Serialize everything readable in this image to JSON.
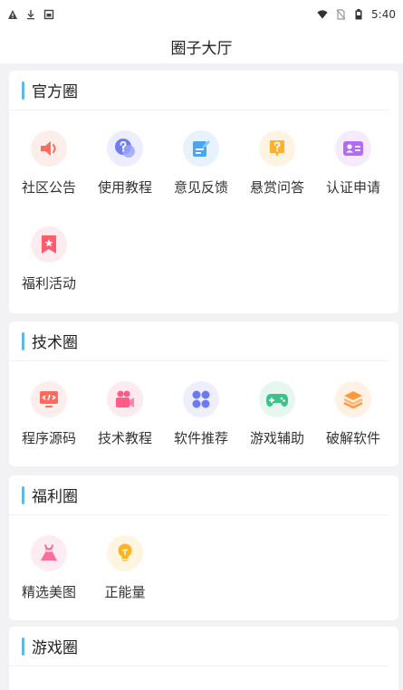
{
  "status_bar": {
    "time": "5:40",
    "left_icons": [
      "warning-icon",
      "download-icon",
      "image-icon"
    ],
    "right_icons": [
      "wifi-icon",
      "no-sim-icon",
      "battery-icon"
    ]
  },
  "header": {
    "title": "圈子大厅"
  },
  "sections": [
    {
      "title": "官方圈",
      "items": [
        {
          "label": "社区公告",
          "icon": "megaphone-icon",
          "color": "#ff6b5b",
          "bg": "#fdeeec"
        },
        {
          "label": "使用教程",
          "icon": "question-bubble-icon",
          "color": "#6f7df3",
          "bg": "#eceefd"
        },
        {
          "label": "意见反馈",
          "icon": "feedback-edit-icon",
          "color": "#4ba5f5",
          "bg": "#e7f2fd"
        },
        {
          "label": "悬赏问答",
          "icon": "reward-question-icon",
          "color": "#ffb02e",
          "bg": "#fff4e2"
        },
        {
          "label": "认证申请",
          "icon": "id-card-icon",
          "color": "#b26cf0",
          "bg": "#f5ebfd"
        },
        {
          "label": "福利活动",
          "icon": "bookmark-star-icon",
          "color": "#ff5d6c",
          "bg": "#fdecef"
        }
      ]
    },
    {
      "title": "技术圈",
      "items": [
        {
          "label": "程序源码",
          "icon": "code-monitor-icon",
          "color": "#ff6a5c",
          "bg": "#fdeeed"
        },
        {
          "label": "技术教程",
          "icon": "video-camera-icon",
          "color": "#ff5a88",
          "bg": "#fdebf1"
        },
        {
          "label": "软件推荐",
          "icon": "apps-grid-icon",
          "color": "#6b79f2",
          "bg": "#edeffd"
        },
        {
          "label": "游戏辅助",
          "icon": "gamepad-icon",
          "color": "#3cc28b",
          "bg": "#e6f7ef"
        },
        {
          "label": "破解软件",
          "icon": "layers-icon",
          "color": "#ff9a3c",
          "bg": "#fff2e5"
        }
      ]
    },
    {
      "title": "福利圈",
      "items": [
        {
          "label": "精选美图",
          "icon": "dress-icon",
          "color": "#ff6e9a",
          "bg": "#fdecf2"
        },
        {
          "label": "正能量",
          "icon": "lightbulb-icon",
          "color": "#ffb41f",
          "bg": "#fff5e0"
        }
      ]
    },
    {
      "title": "游戏圈",
      "items": []
    }
  ]
}
